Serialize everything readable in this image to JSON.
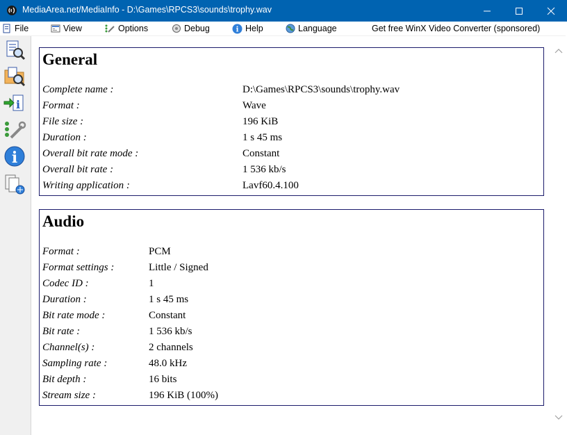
{
  "window": {
    "title": "MediaArea.net/MediaInfo - D:\\Games\\RPCS3\\sounds\\trophy.wav",
    "accent_color": "#0063b1"
  },
  "menu": {
    "file": "File",
    "view": "View",
    "options": "Options",
    "debug": "Debug",
    "help": "Help",
    "language": "Language",
    "sponsored": "Get free WinX Video Converter (sponsored)"
  },
  "toolbar": {
    "icons": [
      "open-file-icon",
      "open-folder-icon",
      "export-icon",
      "options-icon",
      "about-icon",
      "knowledge-base-icon"
    ]
  },
  "general": {
    "title": "General",
    "rows": [
      {
        "label": "Complete name :",
        "value": "D:\\Games\\RPCS3\\sounds\\trophy.wav"
      },
      {
        "label": "Format :",
        "value": "Wave"
      },
      {
        "label": "File size :",
        "value": "196 KiB"
      },
      {
        "label": "Duration :",
        "value": "1 s 45 ms"
      },
      {
        "label": "Overall bit rate mode :",
        "value": "Constant"
      },
      {
        "label": "Overall bit rate :",
        "value": "1 536 kb/s"
      },
      {
        "label": "Writing application :",
        "value": "Lavf60.4.100"
      }
    ]
  },
  "audio": {
    "title": "Audio",
    "rows": [
      {
        "label": "Format :",
        "value": "PCM"
      },
      {
        "label": "Format settings :",
        "value": "Little / Signed"
      },
      {
        "label": "Codec ID :",
        "value": "1"
      },
      {
        "label": "Duration :",
        "value": "1 s 45 ms"
      },
      {
        "label": "Bit rate mode :",
        "value": "Constant"
      },
      {
        "label": "Bit rate :",
        "value": "1 536 kb/s"
      },
      {
        "label": "Channel(s) :",
        "value": "2 channels"
      },
      {
        "label": "Sampling rate :",
        "value": "48.0 kHz"
      },
      {
        "label": "Bit depth :",
        "value": "16 bits"
      },
      {
        "label": "Stream size :",
        "value": "196 KiB (100%)"
      }
    ]
  }
}
